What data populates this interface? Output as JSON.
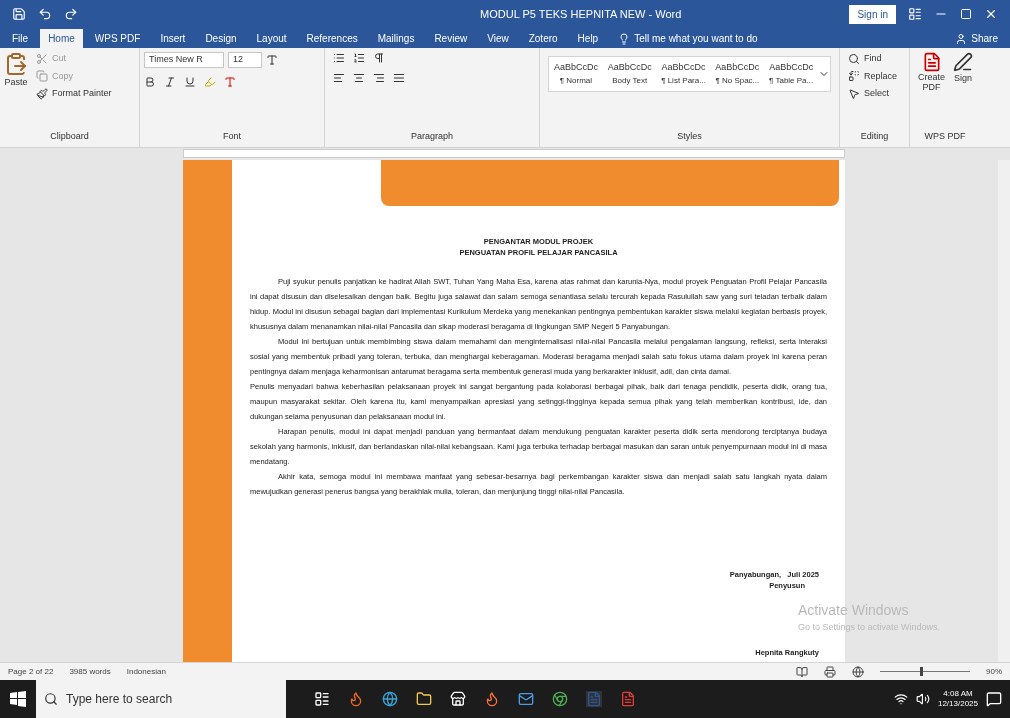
{
  "window": {
    "title": "MODUL P5 TEKS HEPNITA NEW - Word",
    "sign_in": "Sign in"
  },
  "ribbon_tabs": [
    {
      "label": "File",
      "selected": false
    },
    {
      "label": "Home",
      "selected": true
    },
    {
      "label": "WPS PDF",
      "selected": false
    },
    {
      "label": "Insert",
      "selected": false
    },
    {
      "label": "Design",
      "selected": false
    },
    {
      "label": "Layout",
      "selected": false
    },
    {
      "label": "References",
      "selected": false
    },
    {
      "label": "Mailings",
      "selected": false
    },
    {
      "label": "Review",
      "selected": false
    },
    {
      "label": "View",
      "selected": false
    },
    {
      "label": "Zotero",
      "selected": false
    },
    {
      "label": "Help",
      "selected": false
    }
  ],
  "tell_me": "Tell me what you want to do",
  "share": "Share",
  "clipboard": {
    "paste": "Paste",
    "cut": "Cut",
    "copy": "Copy",
    "format_painter": "Format Painter",
    "label": "Clipboard"
  },
  "font": {
    "font_name": "Times New R",
    "font_size": "12",
    "label": "Font"
  },
  "paragraph": {
    "label": "Paragraph"
  },
  "styles": {
    "label": "Styles",
    "items": [
      {
        "preview": "AaBbCcDc",
        "name": "¶ Normal"
      },
      {
        "preview": "AaBbCcDc",
        "name": "Body Text"
      },
      {
        "preview": "AaBbCcDc",
        "name": "¶ List Para..."
      },
      {
        "preview": "AaBbCcDc",
        "name": "¶ No Spac..."
      },
      {
        "preview": "AaBbCcDc",
        "name": "¶ Table Pa..."
      }
    ]
  },
  "editing": {
    "label": "Editing",
    "find": "Find",
    "replace": "Replace",
    "select": "Select"
  },
  "wps_pdf": {
    "label": "WPS PDF",
    "create": "Create PDF",
    "sign": "Sign"
  },
  "document": {
    "title_lines": [
      "PENGANTAR MODUL PROJEK",
      "PENGUATAN PROFIL PELAJAR PANCASILA"
    ],
    "paragraphs": [
      {
        "text": "Puji syukur penulis panjatkan ke hadirat Allah SWT, Tuhan Yang Maha Esa, karena atas rahmat dan karunia-Nya, modul proyek Penguatan Profil Pelajar Pancasila ini dapat disusun dan diselesaikan dengan baik. Begitu juga salawat dan salam semoga senantiasa selalu tercurah kepada Rasulullah saw yang suri teladan terbaik dalam hidup. Modul ini disusun sebagai bagian dari implementasi Kurikulum Merdeka yang menekankan pentingnya pembentukan karakter siswa melalui kegiatan berbasis proyek, khususnya dalam menanamkan nilai-nilai Pancasila dan sikap moderasi beragama di lingkungan SMP Negeri 5 Panyabungan.",
        "indent": true
      },
      {
        "text": "Modul ini bertujuan untuk membimbing siswa dalam memahami dan menginternalisasi nilai-nilai Pancasila melalui pengalaman langsung, refleksi, serta interaksi sosial yang membentuk pribadi yang toleran, terbuka, dan menghargai keberagaman. Moderasi beragama menjadi salah satu fokus utama dalam proyek ini karena peran pentingnya dalam menjaga keharmonisan antarumat beragama serta membentuk generasi muda yang berkarakter inklusif, adil, dan cinta damai.",
        "indent": true
      },
      {
        "text": "Penulis menyadari bahwa keberhasilan pelaksanaan proyek ini sangat bergantung pada kolaborasi berbagai pihak, baik dari tenaga pendidik, peserta didik, orang tua, maupun masyarakat sekitar. Oleh karena itu, kami menyampaikan apresiasi yang setinggi-tingginya kepada semua pihak yang telah memberikan kontribusi, ide, dan dukungan selama penyusunan dan pelaksanaan modul ini.",
        "indent": false
      },
      {
        "text": "Harapan penulis, modul ini dapat menjadi panduan yang bermanfaat dalam mendukung penguatan karakter peserta didik serta mendorong terciptanya budaya sekolah yang harmonis, inklusif, dan berlandaskan nilai-nilai kebangsaan. Kami juga terbuka terhadap berbagai masukan dan saran untuk penyempurnaan modul ini di masa mendatang.",
        "indent": true
      },
      {
        "text": "Akhir kata, semoga modul ini membawa manfaat yang sebesar-besarnya bagi perkembangan karakter siswa dan menjadi salah satu langkah nyata dalam mewujudkan generasi penerus bangsa yang berakhlak mulia, toleran, dan menjunjung tinggi nilai-nilai Pancasila.",
        "indent": true
      }
    ],
    "place_date": "Panyabungan,   Juli 2025",
    "role": "Penyusun",
    "signer": "Hepnita Rangkuty"
  },
  "activation": {
    "title": "Activate Windows",
    "subtitle": "Go to Settings to activate Windows."
  },
  "status_bar": {
    "page": "Page 2 of 22",
    "words": "3985 words",
    "language": "Indonesian",
    "zoom": "90%",
    "zoom_slider": {
      "level": 0.45
    }
  },
  "taskbar": {
    "search_placeholder": "Type here to search",
    "time": "4:08 AM",
    "date": "12/13/2025"
  }
}
